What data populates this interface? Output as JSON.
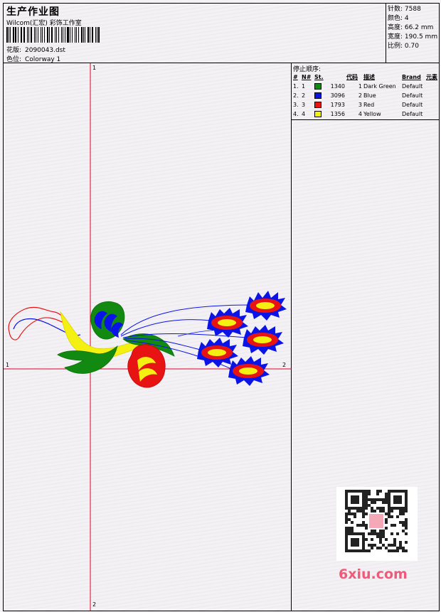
{
  "header": {
    "title": "生产作业图",
    "company": "Wilcom(汇宏) 彩饰工作室",
    "design_label": "花版:",
    "design_value": "2090043.dst",
    "colorway_label": "色位:",
    "colorway_value": "Colorway 1"
  },
  "stats": [
    {
      "label": "针数:",
      "value": "7588"
    },
    {
      "label": "颜色:",
      "value": "4"
    },
    {
      "label": "高度:",
      "value": "66.2 mm"
    },
    {
      "label": "宽度:",
      "value": "190.5 mm"
    },
    {
      "label": "比例:",
      "value": "0.70"
    }
  ],
  "axes": {
    "top": "1",
    "bottom": "2",
    "left": "1",
    "right": "2"
  },
  "stop_sequence": {
    "title": "停止顺序:",
    "columns": [
      "#",
      "N#",
      "St.",
      "代码",
      "描述",
      "Brand",
      "元素"
    ],
    "rows": [
      {
        "idx": "1.",
        "n": "1",
        "color": "#128a12",
        "st": "1340",
        "code": "1",
        "desc": "Dark Green",
        "brand": "Default",
        "elem": ""
      },
      {
        "idx": "2.",
        "n": "2",
        "color": "#0a14e6",
        "st": "3096",
        "code": "2",
        "desc": "Blue",
        "brand": "Default",
        "elem": ""
      },
      {
        "idx": "3.",
        "n": "3",
        "color": "#e81414",
        "st": "1793",
        "code": "3",
        "desc": "Red",
        "brand": "Default",
        "elem": ""
      },
      {
        "idx": "4.",
        "n": "4",
        "color": "#f4f012",
        "st": "1356",
        "code": "4",
        "desc": "Yellow",
        "brand": "Default",
        "elem": ""
      }
    ]
  },
  "watermark": "6xiu.com",
  "colors": {
    "axis": "#e0002a",
    "green": "#128a12",
    "blue": "#0a14e6",
    "red": "#e81414",
    "yellow": "#f4f012"
  }
}
